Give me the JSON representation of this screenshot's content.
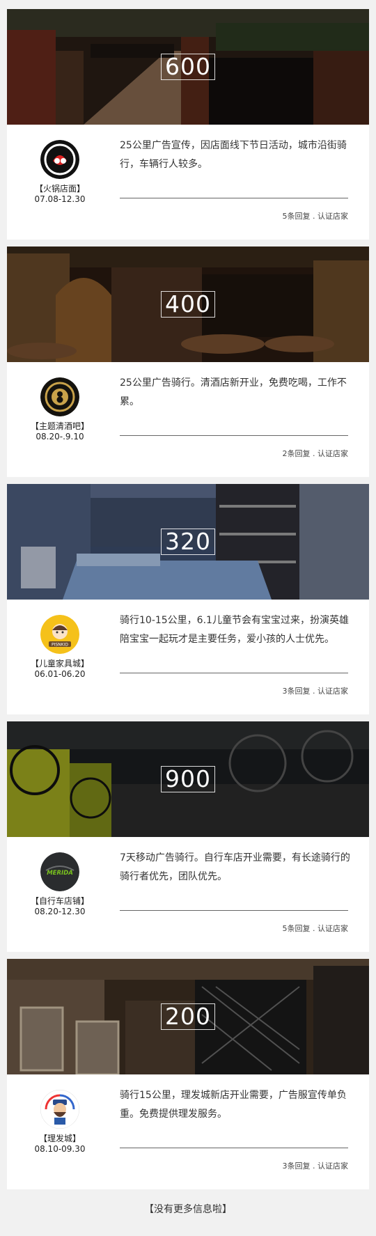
{
  "listings": [
    {
      "price": "600",
      "shop": "【火锅店面】",
      "dates": "07.08-12.30",
      "description": "25公里广告宣传，因店面线下节日活动，城市沿街骑行，车辆行人较多。",
      "replies": "5条回复 . 认证店家",
      "logo_text": ""
    },
    {
      "price": "400",
      "shop": "【主题清酒吧】",
      "dates": "08.20-.9.10",
      "description": "25公里广告骑行。清酒店新开业，免费吃喝，工作不累。",
      "replies": "2条回复 . 认证店家",
      "logo_text": ""
    },
    {
      "price": "320",
      "shop": "【儿童家具城】",
      "dates": "06.01-06.20",
      "description": "骑行10-15公里，6.1儿童节会有宝宝过来，扮演英雄陪宝宝一起玩才是主要任务，爱小孩的人士优先。",
      "replies": "3条回复 . 认证店家",
      "logo_text": "PISNKID"
    },
    {
      "price": "900",
      "shop": "【自行车店铺】",
      "dates": "08.20-12.30",
      "description": "7天移动广告骑行。自行车店开业需要，有长途骑行的骑行者优先，团队优先。",
      "replies": "5条回复 . 认证店家",
      "logo_text": "MERIDA"
    },
    {
      "price": "200",
      "shop": "【理发城】",
      "dates": "08.10-09.30",
      "description": "骑行15公里，理发城新店开业需要，广告服宣传单负重。免费提供理发服务。",
      "replies": "3条回复 . 认证店家",
      "logo_text": ""
    }
  ],
  "footer": {
    "text": "【没有更多信息啦】"
  }
}
